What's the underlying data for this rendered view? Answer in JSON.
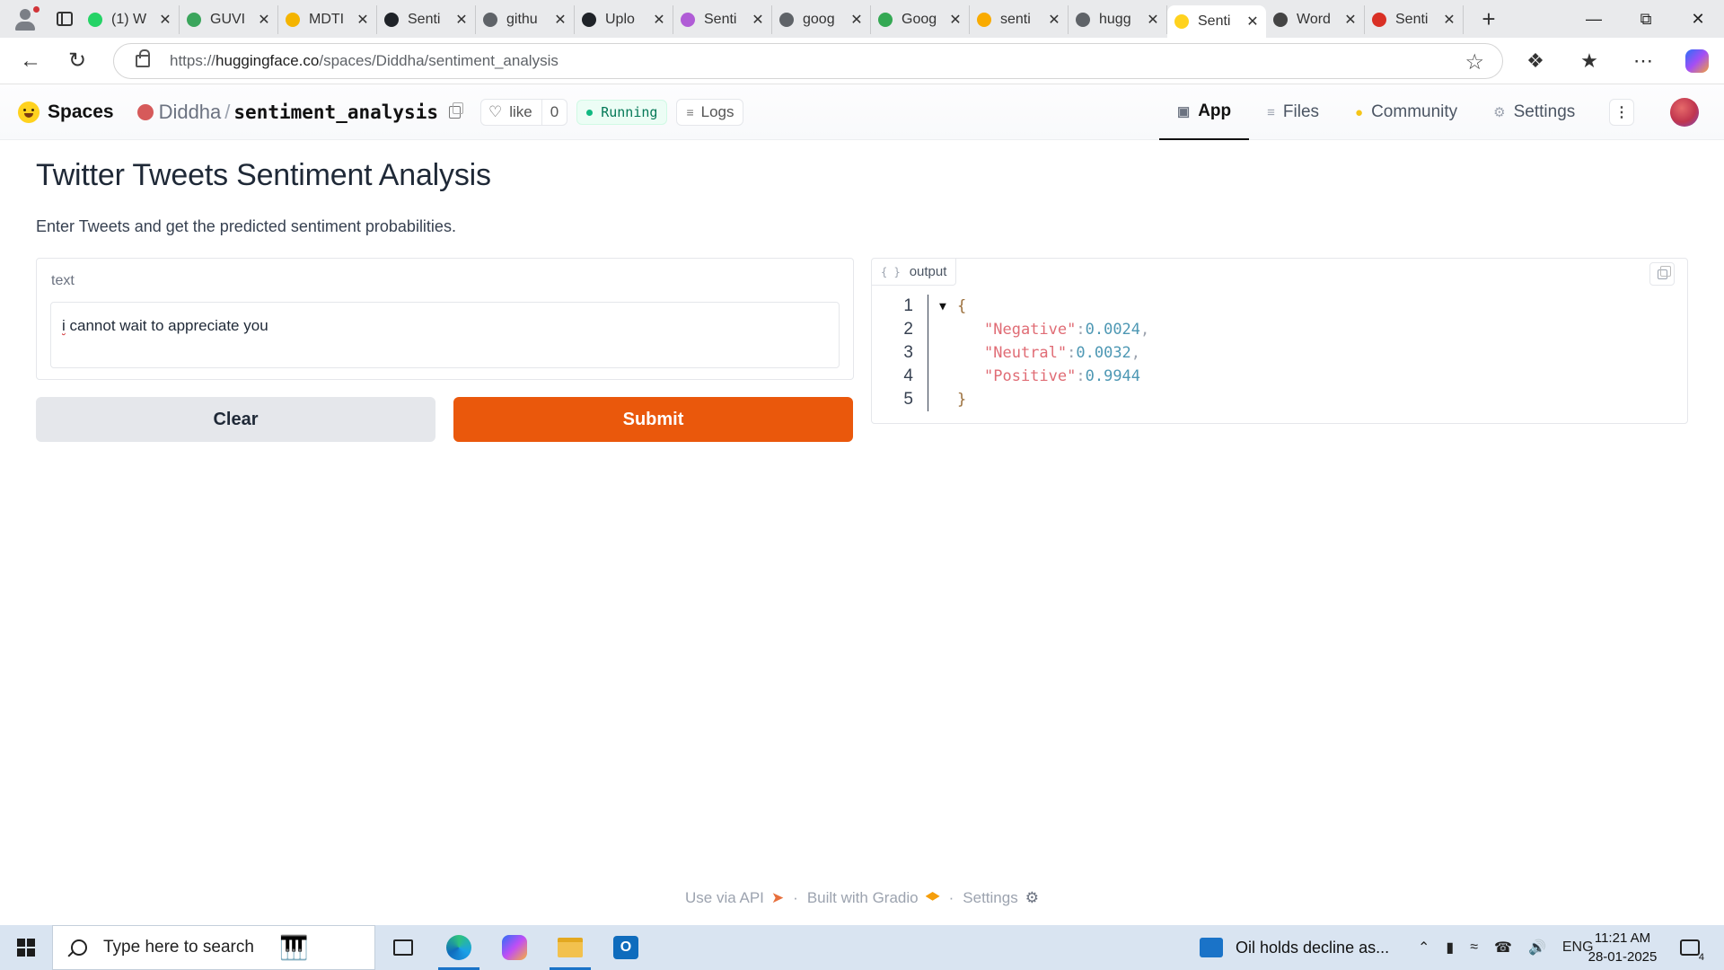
{
  "browser": {
    "tabs": [
      {
        "title": "(1) W",
        "icon": "whatsapp-icon",
        "color": "#25d366"
      },
      {
        "title": "GUVI",
        "icon": "guvi-icon",
        "color": "#3ba55c"
      },
      {
        "title": "MDTI",
        "icon": "google-drive-icon",
        "color": "#f4b400"
      },
      {
        "title": "Senti",
        "icon": "github-icon",
        "color": "#1f2328"
      },
      {
        "title": "githu",
        "icon": "search-icon",
        "color": "#5f6368"
      },
      {
        "title": "Uplo",
        "icon": "github-icon",
        "color": "#1f2328"
      },
      {
        "title": "Senti",
        "icon": "streamlit-icon",
        "color": "#b05cd6"
      },
      {
        "title": "goog",
        "icon": "search-icon",
        "color": "#5f6368"
      },
      {
        "title": "Goog",
        "icon": "google-maps-icon",
        "color": "#34a853"
      },
      {
        "title": "senti",
        "icon": "colab-icon",
        "color": "#f9ab00"
      },
      {
        "title": "hugg",
        "icon": "search-icon",
        "color": "#5f6368"
      },
      {
        "title": "Senti",
        "icon": "huggingface-icon",
        "color": "#ffd21e"
      },
      {
        "title": "Word",
        "icon": "chatgpt-icon",
        "color": "#444444"
      },
      {
        "title": "Senti",
        "icon": "pdf-icon",
        "color": "#d93025"
      }
    ],
    "active_tab_index": 11,
    "url_prefix": "https://",
    "url_domain": "huggingface.co",
    "url_path": "/spaces/Diddha/sentiment_analysis"
  },
  "hf": {
    "brand": "Spaces",
    "owner": "Diddha",
    "separator": "/",
    "repo": "sentiment_analysis",
    "like_label": "like",
    "like_count": "0",
    "status": "Running",
    "logs_label": "Logs",
    "nav": [
      {
        "label": "App",
        "icon": "app-icon",
        "active": true
      },
      {
        "label": "Files",
        "icon": "files-icon",
        "active": false
      },
      {
        "label": "Community",
        "icon": "community-icon",
        "active": false
      },
      {
        "label": "Settings",
        "icon": "gear-icon",
        "active": false
      }
    ]
  },
  "app": {
    "title": "Twitter Tweets Sentiment Analysis",
    "description": "Enter Tweets and get the predicted sentiment probabilities.",
    "input_label": "text",
    "input_value_first": "i",
    "input_value_rest": " cannot wait to appreciate you",
    "clear_label": "Clear",
    "submit_label": "Submit",
    "output_label": "output",
    "output_lines": [
      {
        "n": "1",
        "type": "open",
        "text": "{"
      },
      {
        "n": "2",
        "type": "pair",
        "key": "\"Negative\"",
        "value": "0.0024",
        "comma": ","
      },
      {
        "n": "3",
        "type": "pair",
        "key": "\"Neutral\"",
        "value": "0.0032",
        "comma": ","
      },
      {
        "n": "4",
        "type": "pair",
        "key": "\"Positive\"",
        "value": "0.9944",
        "comma": ""
      },
      {
        "n": "5",
        "type": "close",
        "text": "}"
      }
    ]
  },
  "footer": {
    "api": "Use via API",
    "dot": "·",
    "built": "Built with Gradio",
    "settings": "Settings"
  },
  "taskbar": {
    "search_placeholder": "Type here to search",
    "news": "Oil holds decline as...",
    "lang": "ENG",
    "time": "11:21 AM",
    "date": "28-01-2025",
    "notif_count": "4"
  }
}
